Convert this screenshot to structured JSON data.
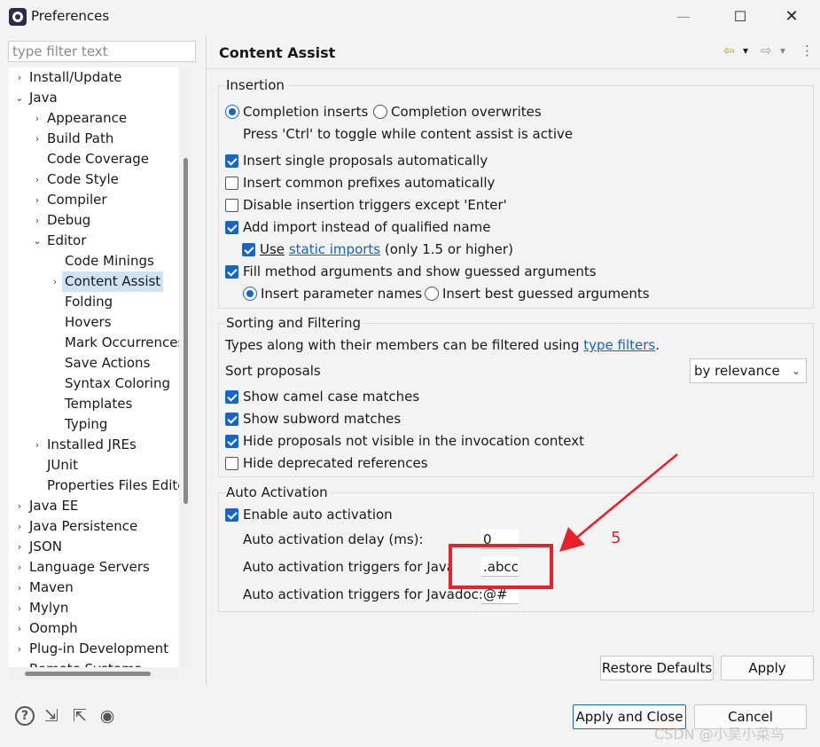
{
  "window": {
    "title": "Preferences",
    "minimize_glyph": "—",
    "maximize_glyph": "☐",
    "close_glyph": "✕"
  },
  "filter": {
    "placeholder": "type filter text",
    "value": ""
  },
  "tree": {
    "items": [
      {
        "label": "Install/Update",
        "level": 0,
        "arrow": "›"
      },
      {
        "label": "Java",
        "level": 0,
        "arrow": "⌄"
      },
      {
        "label": "Appearance",
        "level": 1,
        "arrow": "›"
      },
      {
        "label": "Build Path",
        "level": 1,
        "arrow": "›"
      },
      {
        "label": "Code Coverage",
        "level": 1,
        "arrow": ""
      },
      {
        "label": "Code Style",
        "level": 1,
        "arrow": "›"
      },
      {
        "label": "Compiler",
        "level": 1,
        "arrow": "›"
      },
      {
        "label": "Debug",
        "level": 1,
        "arrow": "›"
      },
      {
        "label": "Editor",
        "level": 1,
        "arrow": "⌄"
      },
      {
        "label": "Code Minings",
        "level": 2,
        "arrow": ""
      },
      {
        "label": "Content Assist",
        "level": 2,
        "arrow": "›",
        "selected": true
      },
      {
        "label": "Folding",
        "level": 2,
        "arrow": ""
      },
      {
        "label": "Hovers",
        "level": 2,
        "arrow": ""
      },
      {
        "label": "Mark Occurrences",
        "level": 2,
        "arrow": ""
      },
      {
        "label": "Save Actions",
        "level": 2,
        "arrow": ""
      },
      {
        "label": "Syntax Coloring",
        "level": 2,
        "arrow": ""
      },
      {
        "label": "Templates",
        "level": 2,
        "arrow": ""
      },
      {
        "label": "Typing",
        "level": 2,
        "arrow": ""
      },
      {
        "label": "Installed JREs",
        "level": 1,
        "arrow": "›"
      },
      {
        "label": "JUnit",
        "level": 1,
        "arrow": ""
      },
      {
        "label": "Properties Files Editor",
        "level": 1,
        "arrow": ""
      },
      {
        "label": "Java EE",
        "level": 0,
        "arrow": "›"
      },
      {
        "label": "Java Persistence",
        "level": 0,
        "arrow": "›"
      },
      {
        "label": "JSON",
        "level": 0,
        "arrow": "›"
      },
      {
        "label": "Language Servers",
        "level": 0,
        "arrow": "›"
      },
      {
        "label": "Maven",
        "level": 0,
        "arrow": "›"
      },
      {
        "label": "Mylyn",
        "level": 0,
        "arrow": "›"
      },
      {
        "label": "Oomph",
        "level": 0,
        "arrow": "›"
      },
      {
        "label": "Plug-in Development",
        "level": 0,
        "arrow": "›"
      },
      {
        "label": "Remote Systems",
        "level": 0,
        "arrow": "›"
      }
    ]
  },
  "page": {
    "title": "Content Assist",
    "nav": {
      "back_glyph": "⇦",
      "back_menu_glyph": "▾",
      "forward_glyph": "⇨",
      "forward_menu_glyph": "▾",
      "menu_glyph": "⋮"
    }
  },
  "insertion": {
    "title": "Insertion",
    "radio_inserts": "Completion inserts",
    "radio_overwrites": "Completion overwrites",
    "toggle_hint": "Press 'Ctrl' to toggle while content assist is active",
    "cb_single": "Insert single proposals automatically",
    "cb_prefixes": "Insert common prefixes automatically",
    "cb_disable_triggers": "Disable insertion triggers except 'Enter'",
    "cb_add_import": "Add import instead of qualified name",
    "cb_use": "Use",
    "static_imports_link": "static imports",
    "static_imports_suffix": "(only 1.5 or higher)",
    "cb_fill_args": "Fill method arguments and show guessed arguments",
    "radio_param_names": "Insert parameter names",
    "radio_best_guessed": "Insert best guessed arguments"
  },
  "sorting": {
    "title": "Sorting and Filtering",
    "types_prefix": "Types along with their members can be filtered using",
    "type_filters_link": "type filters",
    "types_suffix": ".",
    "sort_label": "Sort proposals",
    "sort_value": "by relevance",
    "sort_chevron": "⌄",
    "cb_camel": "Show camel case matches",
    "cb_subword": "Show subword matches",
    "cb_hide_not_visible": "Hide proposals not visible in the invocation context",
    "cb_hide_deprecated": "Hide deprecated references"
  },
  "auto": {
    "title": "Auto Activation",
    "cb_enable": "Enable auto activation",
    "delay_label": "Auto activation delay (ms):",
    "delay_value": "0",
    "java_label": "Auto activation triggers for Java:",
    "java_value": ".abcc",
    "javadoc_label": "Auto activation triggers for Javadoc:",
    "javadoc_value": "@#"
  },
  "buttons": {
    "restore": "Restore Defaults",
    "apply": "Apply",
    "apply_close": "Apply and Close",
    "cancel": "Cancel"
  },
  "footer_icons": {
    "help": "?",
    "import": "⇲",
    "export": "⇱",
    "record": "◉"
  },
  "annotation": {
    "number": "5",
    "color": "#e8202a"
  },
  "watermark": "CSDN @小吴小菜鸟",
  "colors": {
    "accent": "#1766c5",
    "link": "#1a62b9",
    "selection": "#cfe3f6"
  }
}
